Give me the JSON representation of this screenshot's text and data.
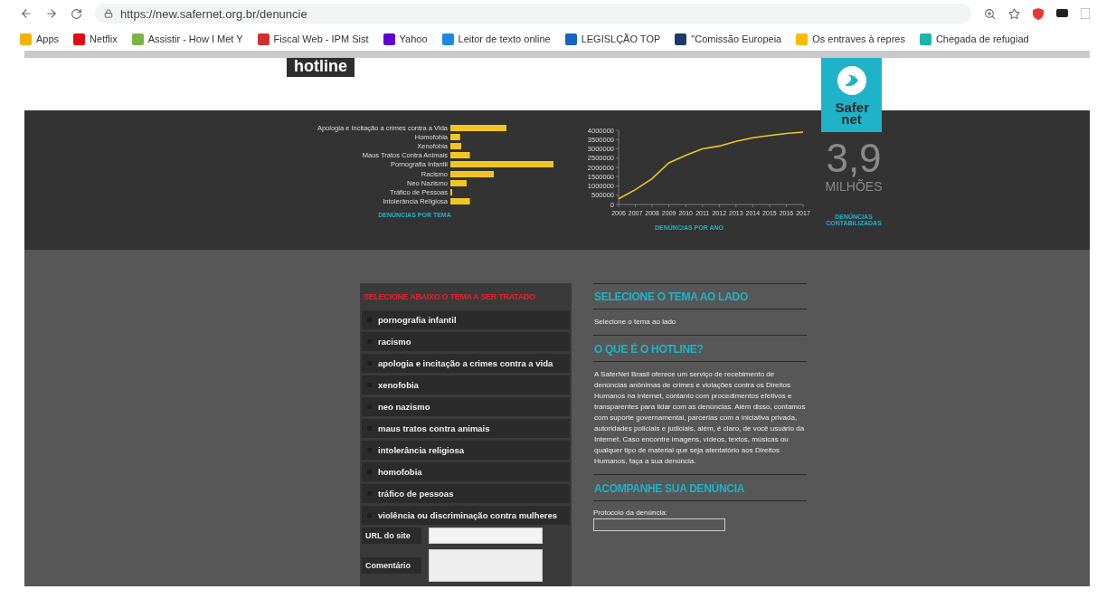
{
  "browser": {
    "url": "https://new.safernet.org.br/denuncie",
    "bookmarks": [
      {
        "label": "Apps",
        "kind": "apps"
      },
      {
        "label": "Netflix",
        "kind": "netflix"
      },
      {
        "label": "Assistir - How I Met Y",
        "kind": "h"
      },
      {
        "label": "Fiscal Web - IPM Sist",
        "kind": "ipm"
      },
      {
        "label": "Yahoo",
        "kind": "yahoo"
      },
      {
        "label": "Leitor de texto online",
        "kind": "globe"
      },
      {
        "label": "LEGISLÇÃO TOP",
        "kind": "chat"
      },
      {
        "label": "\"Comissão Europeia",
        "kind": "doc"
      },
      {
        "label": "Os entraves à repres",
        "kind": "drive"
      },
      {
        "label": "Chegada de refugiad",
        "kind": "teal"
      }
    ]
  },
  "header": {
    "badge": "hotline",
    "logo": "Safer net"
  },
  "stats": {
    "topics_chart": {
      "labels": [
        "Apologia e Incitação a crimes contra a Vida",
        "Homofobia",
        "Xenofobia",
        "Maus Tratos Contra Animais",
        "Pornografia Infantil",
        "Racismo",
        "Neo Nazismo",
        "Tráfico de Pessoas",
        "Intolerância Religiosa"
      ],
      "caption": "DENÚNCIAS POR TEMA"
    },
    "year_chart": {
      "caption": "DENÚNCIAS POR ANO",
      "chart_data": {
        "type": "line",
        "x": [
          2006,
          2007,
          2008,
          2009,
          2010,
          2011,
          2012,
          2013,
          2014,
          2015,
          2016,
          2017
        ],
        "series": [
          {
            "color": "#f2c522",
            "values": [
              300000,
              800000,
              1400000,
              2250000,
              2650000,
              3000000,
              3150000,
              3400000,
              3600000,
              3720000,
              3830000,
              3900000
            ]
          }
        ],
        "xlim": [
          2006,
          2017
        ],
        "ylim": [
          0,
          4000000
        ],
        "yticks": [
          0,
          500000,
          1000000,
          1500000,
          2000000,
          2500000,
          3000000,
          3500000,
          4000000
        ],
        "xticks": [
          2006,
          2007,
          2008,
          2009,
          2010,
          2011,
          2012,
          2013,
          2014,
          2015,
          2016,
          2017
        ]
      }
    },
    "total": {
      "value": "3,9",
      "unit": "MILHÕES",
      "caption": "DENÚNCIAS CONTABILIZADAS"
    }
  },
  "topics": {
    "heading": "SELECIONE ABAIXO O TEMA A SER TRATADO",
    "items": [
      "pornografia infantil",
      "racismo",
      "apologia e incitação a crimes contra a vida",
      "xenofobia",
      "neo nazismo",
      "maus tratos contra animais",
      "intolerância religiosa",
      "homofobia",
      "tráfico de pessoas",
      "violência ou discriminação contra mulheres"
    ],
    "fields": [
      {
        "label": "URL do site",
        "kind": "input"
      },
      {
        "label": "Comentário",
        "kind": "textarea"
      }
    ]
  },
  "info": {
    "sections": [
      {
        "title": "SELECIONE O TEMA AO LADO",
        "text": "Selecione o tema ao lado"
      },
      {
        "title": "O QUE É O HOTLINE?",
        "text": "A SaferNet Brasil oferece um serviço de recebimento de denúncias anônimas de crimes e violações contra os Direitos Humanos na Internet, contanto com procedimentos efetivos e transparentes para lidar com as denúncias. Além disso, contamos com suporte governamental, parcerias com a iniciativa privada, autoridades policiais e judiciais, além, é claro, de você usuário da Internet. Caso encontre imagens, vídeos, textos, músicas ou qualquer tipo de material que seja atentatório aos Direitos Humanos, faça a sua denúncia."
      },
      {
        "title": "ACOMPANHE SUA DENÚNCIA",
        "field_label": "Protocolo da denúncia:"
      }
    ]
  }
}
